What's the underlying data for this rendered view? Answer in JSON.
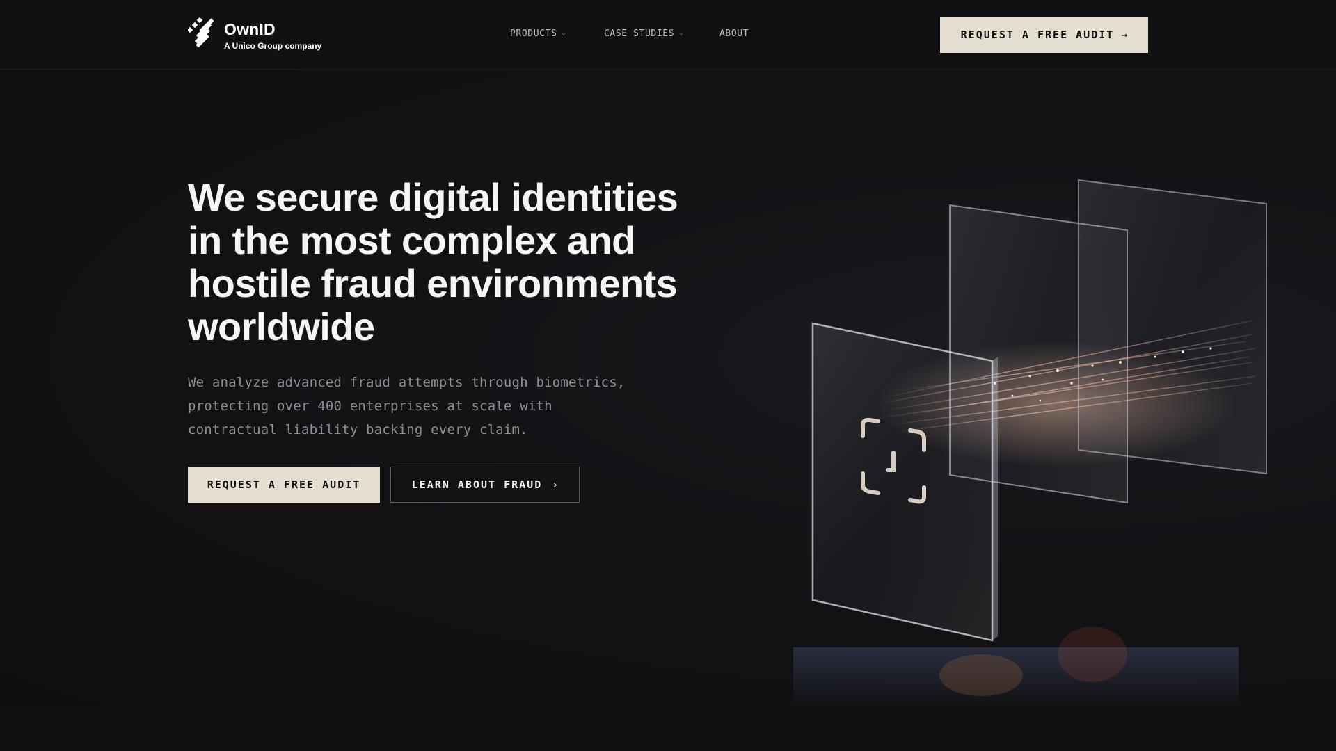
{
  "brand": {
    "name": "OwnID",
    "tagline": "A Unico Group company",
    "logo_icon": "ownid-logo-icon"
  },
  "nav": {
    "items": [
      {
        "label": "PRODUCTS",
        "has_dropdown": true
      },
      {
        "label": "CASE STUDIES",
        "has_dropdown": true
      },
      {
        "label": "ABOUT",
        "has_dropdown": false
      }
    ],
    "cta_label": "REQUEST A FREE AUDIT",
    "cta_icon": "arrow-right-icon"
  },
  "hero": {
    "headline": "We secure digital identities in the most complex and hostile fraud environments worldwide",
    "subcopy": "We analyze advanced fraud attempts through biometrics, protecting over 400 enterprises at scale with contractual liability backing every claim.",
    "primary_cta": "REQUEST A FREE AUDIT",
    "secondary_cta": "LEARN ABOUT FRAUD",
    "secondary_icon": "chevron-right-icon",
    "illustration": "glass-identity-panels-illustration"
  },
  "colors": {
    "background": "#111113",
    "accent_button": "#e3ded0",
    "headline": "#f5f5f5",
    "body_text": "#8e8e94"
  }
}
